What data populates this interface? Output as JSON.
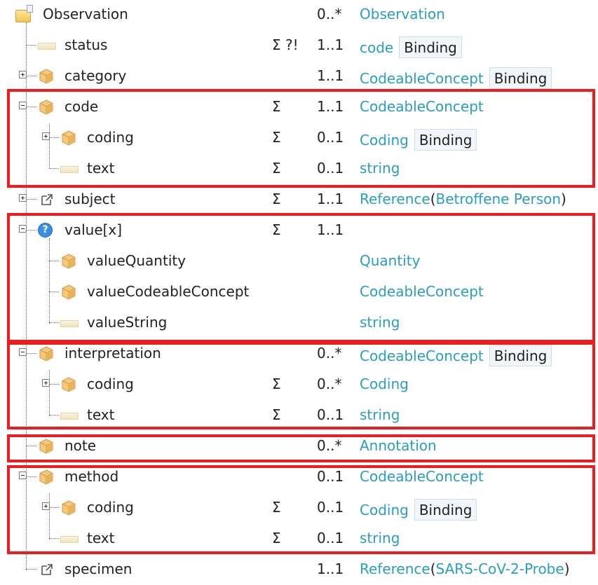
{
  "colors": {
    "link": "#2a9dc2",
    "highlight_box": "#ee1c1c",
    "binding_bg": "#f0f6fa"
  },
  "rows": [
    {
      "icon": "folder-resource-icon",
      "name": "Observation",
      "flags": "",
      "card": "0..*",
      "type": "Observation",
      "binding": ""
    },
    {
      "icon": "primitive-type-icon",
      "name": "status",
      "flags": "Σ ?!",
      "card": "1..1",
      "type": "code",
      "binding": "Binding"
    },
    {
      "icon": "complex-type-icon",
      "name": "category",
      "flags": "",
      "card": "1..1",
      "type": "CodeableConcept",
      "binding": "Binding"
    },
    {
      "icon": "complex-type-icon",
      "name": "code",
      "flags": "Σ",
      "card": "1..1",
      "type": "CodeableConcept",
      "binding": ""
    },
    {
      "icon": "complex-type-icon",
      "name": "coding",
      "flags": "Σ",
      "card": "0..1",
      "type": "Coding",
      "binding": "Binding"
    },
    {
      "icon": "primitive-type-icon",
      "name": "text",
      "flags": "Σ",
      "card": "0..1",
      "type": "string",
      "binding": ""
    },
    {
      "icon": "reference-icon",
      "name": "subject",
      "flags": "Σ",
      "card": "1..1",
      "type": "Reference",
      "target": "Betroffene Person",
      "binding": ""
    },
    {
      "icon": "choice-type-icon",
      "name": "value[x]",
      "flags": "Σ",
      "card": "1..1",
      "type": "",
      "binding": ""
    },
    {
      "icon": "complex-type-icon",
      "name": "valueQuantity",
      "flags": "",
      "card": "",
      "type": "Quantity",
      "binding": ""
    },
    {
      "icon": "complex-type-icon",
      "name": "valueCodeableConcept",
      "flags": "",
      "card": "",
      "type": "CodeableConcept",
      "binding": ""
    },
    {
      "icon": "primitive-type-icon",
      "name": "valueString",
      "flags": "",
      "card": "",
      "type": "string",
      "binding": ""
    },
    {
      "icon": "complex-type-icon",
      "name": "interpretation",
      "flags": "",
      "card": "0..*",
      "type": "CodeableConcept",
      "binding": "Binding"
    },
    {
      "icon": "complex-type-icon",
      "name": "coding",
      "flags": "Σ",
      "card": "0..*",
      "type": "Coding",
      "binding": ""
    },
    {
      "icon": "primitive-type-icon",
      "name": "text",
      "flags": "Σ",
      "card": "0..1",
      "type": "string",
      "binding": ""
    },
    {
      "icon": "complex-type-icon",
      "name": "note",
      "flags": "",
      "card": "0..*",
      "type": "Annotation",
      "binding": ""
    },
    {
      "icon": "complex-type-icon",
      "name": "method",
      "flags": "",
      "card": "0..1",
      "type": "CodeableConcept",
      "binding": ""
    },
    {
      "icon": "complex-type-icon",
      "name": "coding",
      "flags": "Σ",
      "card": "0..1",
      "type": "Coding",
      "binding": "Binding"
    },
    {
      "icon": "primitive-type-icon",
      "name": "text",
      "flags": "Σ",
      "card": "0..1",
      "type": "string",
      "binding": ""
    },
    {
      "icon": "reference-icon",
      "name": "specimen",
      "flags": "",
      "card": "1..1",
      "type": "Reference",
      "target": "SARS-CoV-2-Probe",
      "binding": ""
    }
  ]
}
